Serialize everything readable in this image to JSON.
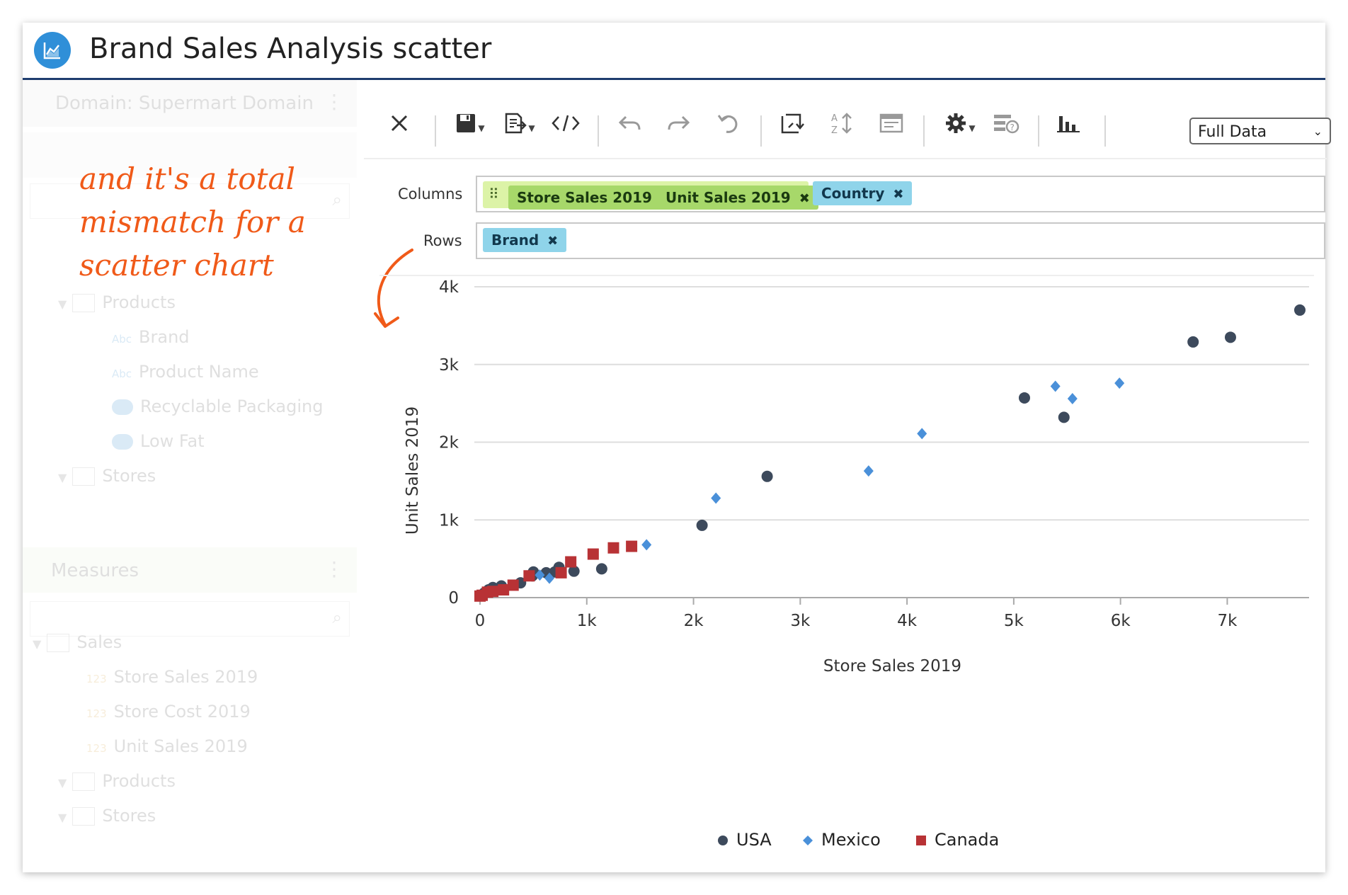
{
  "window": {
    "title": "Brand Sales Analysis scatter",
    "icon": "line-chart-icon"
  },
  "sidebar": {
    "domain_label": "Domain: Supermart Domain",
    "dimensions_tree": [
      {
        "label": "Products",
        "kind": "folder"
      },
      {
        "label": "Brand",
        "kind": "text-field",
        "type_badge": "Abc"
      },
      {
        "label": "Product Name",
        "kind": "text-field",
        "type_badge": "Abc"
      },
      {
        "label": "Recyclable Packaging",
        "kind": "toggle-field"
      },
      {
        "label": "Low Fat",
        "kind": "toggle-field"
      },
      {
        "label": "Stores",
        "kind": "folder"
      }
    ],
    "measures_label": "Measures",
    "measures_tree": [
      {
        "label": "Sales",
        "kind": "folder"
      },
      {
        "label": "Store Sales 2019",
        "kind": "number-field",
        "type_badge": "123"
      },
      {
        "label": "Store Cost 2019",
        "kind": "number-field",
        "type_badge": "123"
      },
      {
        "label": "Unit Sales 2019",
        "kind": "number-field",
        "type_badge": "123"
      },
      {
        "label": "Products",
        "kind": "folder"
      },
      {
        "label": "Stores",
        "kind": "folder"
      }
    ]
  },
  "annotation": {
    "text_lines": [
      "and it's a total",
      "mismatch for a",
      "scatter chart"
    ],
    "color": "#f05a19"
  },
  "toolbar": {
    "icons": [
      "close-icon",
      "save-icon",
      "export-icon",
      "code-icon",
      "undo-icon",
      "redo-icon",
      "reset-icon",
      "switch-axes-icon",
      "sort-icon",
      "table-icon",
      "settings-icon",
      "filter-help-icon",
      "chart-type-icon"
    ],
    "data_mode": "Full Data"
  },
  "shelves": {
    "columns_label": "Columns",
    "rows_label": "Rows",
    "columns": [
      {
        "label": "Store Sales 2019",
        "color": "green"
      },
      {
        "label": "Unit Sales 2019",
        "color": "green"
      },
      {
        "label": "Country",
        "color": "blue"
      }
    ],
    "rows": [
      {
        "label": "Brand",
        "color": "blue"
      }
    ]
  },
  "chart_data": {
    "type": "scatter",
    "xlabel": "Store Sales 2019",
    "ylabel": "Unit Sales 2019",
    "xlim": [
      0,
      7700
    ],
    "ylim": [
      0,
      4000
    ],
    "x_ticks": [
      0,
      1000,
      2000,
      3000,
      4000,
      5000,
      6000,
      7000
    ],
    "x_tick_labels": [
      "0",
      "1k",
      "2k",
      "3k",
      "4k",
      "5k",
      "6k",
      "7k"
    ],
    "y_ticks": [
      0,
      1000,
      2000,
      3000,
      4000
    ],
    "y_tick_labels": [
      "0",
      "1k",
      "2k",
      "3k",
      "4k"
    ],
    "grid": "horizontal",
    "legend_position": "bottom-center",
    "series": [
      {
        "name": "USA",
        "marker": "circle",
        "color": "#3d4a5c",
        "points": [
          [
            7680,
            3700
          ],
          [
            7030,
            3350
          ],
          [
            6680,
            3290
          ],
          [
            5100,
            2570
          ],
          [
            5470,
            2320
          ],
          [
            2690,
            1560
          ],
          [
            2080,
            930
          ],
          [
            1140,
            370
          ],
          [
            880,
            340
          ],
          [
            740,
            390
          ],
          [
            700,
            330
          ],
          [
            620,
            320
          ],
          [
            500,
            330
          ],
          [
            490,
            280
          ],
          [
            380,
            190
          ],
          [
            200,
            150
          ],
          [
            120,
            130
          ],
          [
            80,
            100
          ],
          [
            40,
            60
          ]
        ]
      },
      {
        "name": "Mexico",
        "marker": "diamond",
        "color": "#4a90d9",
        "points": [
          [
            5990,
            2760
          ],
          [
            5390,
            2720
          ],
          [
            5550,
            2560
          ],
          [
            4140,
            2110
          ],
          [
            3640,
            1630
          ],
          [
            2210,
            1280
          ],
          [
            1560,
            680
          ],
          [
            650,
            250
          ],
          [
            560,
            290
          ]
        ]
      },
      {
        "name": "Canada",
        "marker": "square",
        "color": "#b83235",
        "points": [
          [
            1420,
            660
          ],
          [
            1250,
            640
          ],
          [
            1060,
            560
          ],
          [
            850,
            460
          ],
          [
            760,
            320
          ],
          [
            460,
            280
          ],
          [
            310,
            160
          ],
          [
            220,
            100
          ],
          [
            120,
            80
          ],
          [
            70,
            70
          ],
          [
            20,
            30
          ],
          [
            0,
            20
          ]
        ]
      }
    ]
  }
}
